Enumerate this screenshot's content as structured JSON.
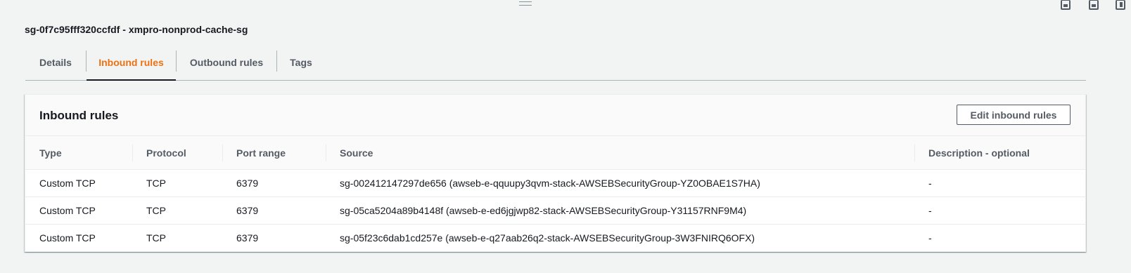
{
  "security_group": {
    "title": "sg-0f7c95fff320ccfdf - xmpro-nonprod-cache-sg"
  },
  "tabs": [
    {
      "label": "Details",
      "active": false
    },
    {
      "label": "Inbound rules",
      "active": true
    },
    {
      "label": "Outbound rules",
      "active": false
    },
    {
      "label": "Tags",
      "active": false
    }
  ],
  "inbound": {
    "heading": "Inbound rules",
    "edit_button": "Edit inbound rules",
    "columns": [
      "Type",
      "Protocol",
      "Port range",
      "Source",
      "Description - optional"
    ],
    "rows": [
      {
        "type": "Custom TCP",
        "protocol": "TCP",
        "port_range": "6379",
        "source": "sg-002412147297de656 (awseb-e-qquupy3qvm-stack-AWSEBSecurityGroup-YZ0OBAE1S7HA)",
        "description": "-"
      },
      {
        "type": "Custom TCP",
        "protocol": "TCP",
        "port_range": "6379",
        "source": "sg-05ca5204a89b4148f (awseb-e-ed6jgjwp82-stack-AWSEBSecurityGroup-Y31157RNF9M4)",
        "description": "-"
      },
      {
        "type": "Custom TCP",
        "protocol": "TCP",
        "port_range": "6379",
        "source": "sg-05f23c6dab1cd257e (awseb-e-q27aab26q2-stack-AWSEBSecurityGroup-3W3FNIRQ6OFX)",
        "description": "-"
      }
    ]
  },
  "icons": {
    "drag_handle": "drag-handle-icon",
    "panel_bottom": "panel-bottom-icon",
    "panel_bottom_alt": "panel-bottom-alt-icon",
    "panel_side": "panel-side-icon"
  },
  "colors": {
    "accent_tab": "#ec7211",
    "page_bg": "#f2f3f3",
    "text_primary": "#16191f",
    "text_secondary": "#545b64"
  }
}
